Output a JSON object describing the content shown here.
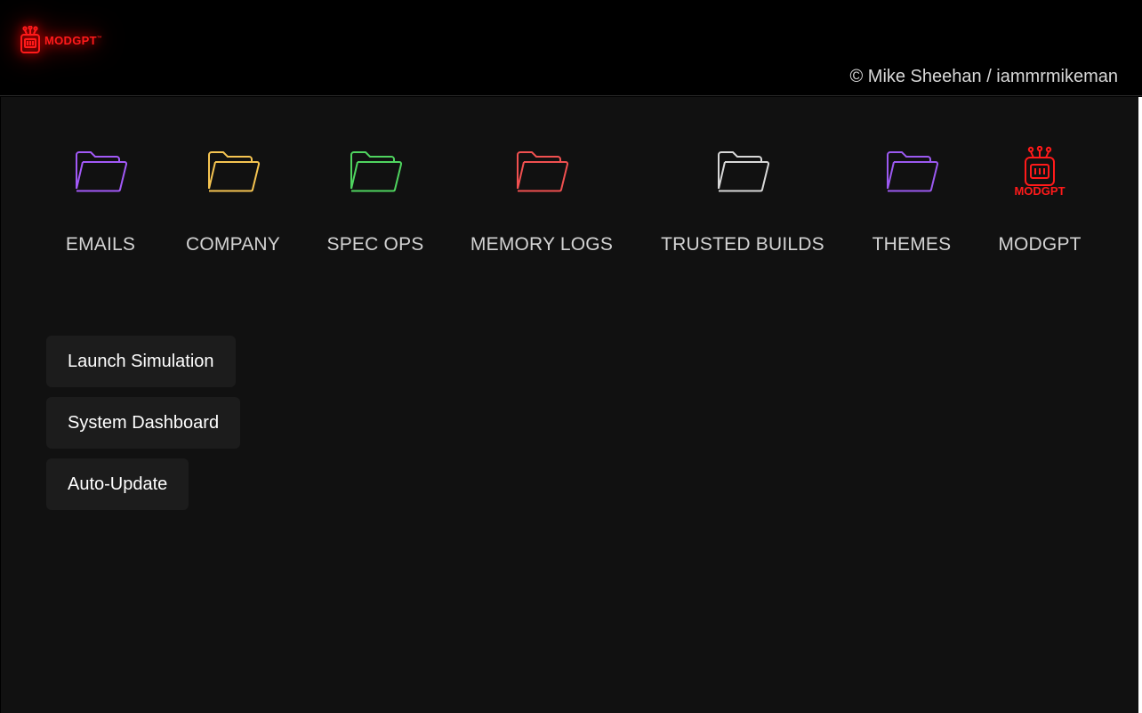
{
  "header": {
    "logo_text": "MODGPT",
    "logo_tm": "™",
    "credit": "© Mike Sheehan / iammrmikeman"
  },
  "desktop": {
    "items": [
      {
        "label": "EMAILS",
        "icon": "folder-icon",
        "color": "#a259f7"
      },
      {
        "label": "COMPANY",
        "icon": "folder-icon",
        "color": "#f5c451"
      },
      {
        "label": "SPEC OPS",
        "icon": "folder-icon",
        "color": "#4fd45f"
      },
      {
        "label": "MEMORY LOGS",
        "icon": "folder-icon",
        "color": "#f05050"
      },
      {
        "label": "TRUSTED BUILDS",
        "icon": "folder-icon",
        "color": "#d8d8d8"
      },
      {
        "label": "THEMES",
        "icon": "folder-icon",
        "color": "#9b59f0"
      },
      {
        "label": "MODGPT",
        "icon": "modgpt-robot-icon",
        "color": "#ff1a1a",
        "icon_text": "MODGPT"
      }
    ]
  },
  "actions": {
    "launch_simulation": "Launch Simulation",
    "system_dashboard": "System Dashboard",
    "auto_update": "Auto-Update"
  }
}
